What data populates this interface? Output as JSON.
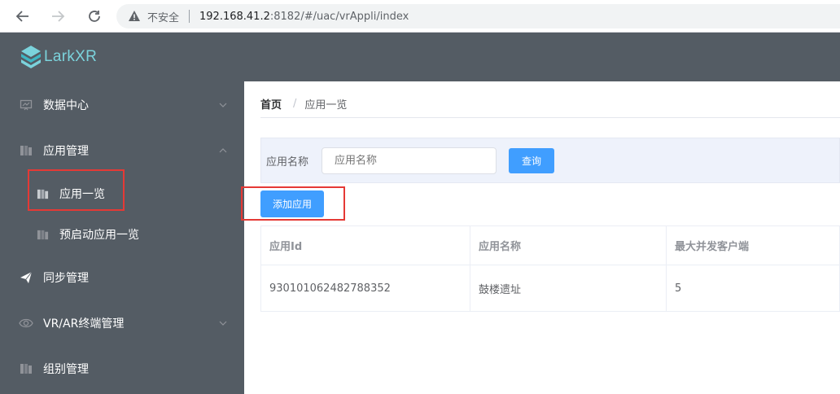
{
  "browser": {
    "insecure_label": "不安全",
    "url_host": "192.168.41.2",
    "url_path": ":8182/#/uac/vrAppli/index"
  },
  "header": {
    "logo_text": "LarkXR"
  },
  "sidebar": {
    "items": [
      {
        "label": "数据中心",
        "icon": "chart-board-icon",
        "expanded": false
      },
      {
        "label": "应用管理",
        "icon": "app-grid-icon",
        "expanded": true
      },
      {
        "label": "应用一览",
        "icon": "app-grid-icon",
        "sub": true,
        "active": true
      },
      {
        "label": "预启动应用一览",
        "icon": "app-grid-icon",
        "sub": true
      },
      {
        "label": "同步管理",
        "icon": "send-icon"
      },
      {
        "label": "VR/AR终端管理",
        "icon": "eye-icon",
        "expanded": false
      },
      {
        "label": "组别管理",
        "icon": "app-grid-icon"
      }
    ]
  },
  "breadcrumb": {
    "home": "首页",
    "separator": "/",
    "current": "应用一览"
  },
  "search": {
    "label": "应用名称",
    "placeholder": "应用名称",
    "value": "",
    "button_label": "查询"
  },
  "actions": {
    "add_label": "添加应用"
  },
  "table": {
    "headers": [
      "应用Id",
      "应用名称",
      "最大并发客户端"
    ],
    "rows": [
      [
        "930101062482788352",
        "鼓楼遗址",
        "5"
      ]
    ]
  },
  "colors": {
    "sidebar": "#545c64",
    "primary": "#409eff",
    "highlight_box": "#e53935",
    "logo": "#7bd3dc"
  }
}
